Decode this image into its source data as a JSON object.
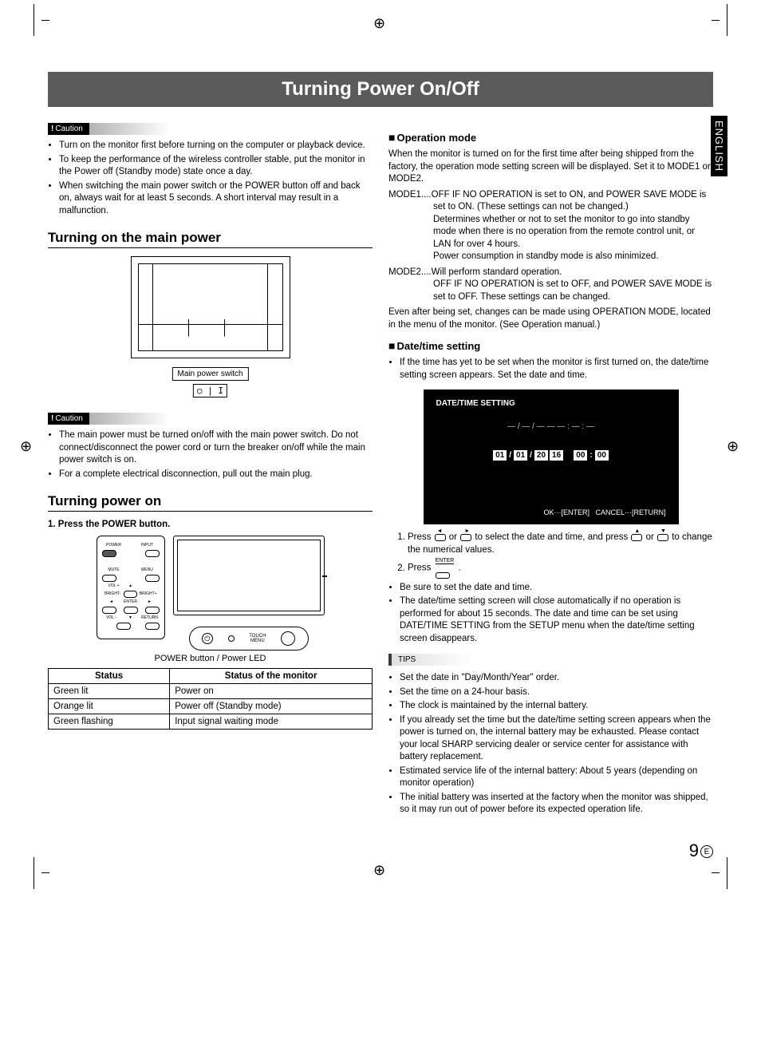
{
  "language_tab": "ENGLISH",
  "page_title": "Turning Power On/Off",
  "page_number": "9",
  "page_lang_mark": "E",
  "caution_label": "Caution",
  "caution_top": [
    "Turn on the monitor first before turning on the computer or playback device.",
    "To keep the performance of the wireless controller stable, put the monitor in the Power off (Standby mode) state once a day.",
    "When switching the main power switch or the POWER button off and back on, always wait for at least 5 seconds. A short interval may result in a malfunction."
  ],
  "section1_title": "Turning on the main power",
  "main_power_label": "Main power switch",
  "main_power_symbol": "○ | I",
  "caution_mid": [
    "The main power must be turned on/off with the main power switch. Do not connect/disconnect the power cord or turn the breaker on/off while the main power switch is on.",
    "For a complete electrical disconnection, pull out the main plug."
  ],
  "section2_title": "Turning power on",
  "step1": "1. Press the POWER button.",
  "remote": {
    "power": "POWER",
    "input": "INPUT",
    "mute": "MUTE",
    "menu": "MENU",
    "volp": "VOL +",
    "brightm": "BRIGHT-",
    "brightp": "BRIGHT+",
    "left": "◄",
    "enter": "ENTER",
    "right": "►",
    "volm": "VOL -",
    "down": "▼",
    "return": "RETURN"
  },
  "control_bar": {
    "touch_menu": "TOUCH\nMENU"
  },
  "fig_caption": "POWER button / Power LED",
  "led_table": {
    "headers": [
      "Status",
      "Status of the monitor"
    ],
    "rows": [
      [
        "Green lit",
        "Power on"
      ],
      [
        "Orange lit",
        "Power off (Standby mode)"
      ],
      [
        "Green flashing",
        "Input signal waiting mode"
      ]
    ]
  },
  "op_mode_title": "Operation mode",
  "op_mode_intro": "When the monitor is turned on for the first time after being shipped from the factory, the operation mode setting screen will be displayed. Set it to MODE1 or MODE2.",
  "mode1": "MODE1....OFF IF NO OPERATION is set to ON, and POWER SAVE MODE is set to ON. (These settings can not be changed.)\nDetermines whether or not to set the monitor to go into standby mode when there is no operation from the remote control unit, or LAN for over 4 hours.\nPower consumption in standby mode is also minimized.",
  "mode2": "MODE2....Will perform standard operation.\nOFF IF NO OPERATION is set to OFF, and POWER SAVE MODE is set to OFF. These settings can be changed.",
  "op_mode_note": "Even after being set, changes can be made using OPERATION MODE, located in the menu of the monitor. (See Operation manual.)",
  "dt_title": "Date/time setting",
  "dt_intro": "If the time has yet to be set when the monitor is first turned on, the date/time setting screen appears. Set the date and time.",
  "dt_screen": {
    "title": "DATE/TIME SETTING",
    "blank": "— / — / — —    — : — : —",
    "d1": "01",
    "d2": "01",
    "y1": "20",
    "y2": "16",
    "h": "00",
    "m": "00",
    "ok": "OK···[ENTER]",
    "cancel": "CANCEL···[RETURN]"
  },
  "dt_steps": {
    "s1a": "Press ",
    "s1b": " or ",
    "s1c": " to select the date and time, and press ",
    "s1d": " or ",
    "s1e": " to change the numerical values.",
    "s2a": "Press ",
    "s2_enter": "ENTER",
    "s2b": " ."
  },
  "dt_bullets": [
    "Be sure to set the date and time.",
    "The date/time setting screen will close automatically if no operation is performed for about 15 seconds. The date and time can be set using DATE/TIME SETTING from the SETUP menu when the date/time setting screen disappears."
  ],
  "tips_label": "TIPS",
  "tips_list": [
    "Set the date in \"Day/Month/Year\" order.",
    "Set the time on a 24-hour basis.",
    "The clock is maintained by the internal battery.",
    "If you already set the time but the date/time setting screen appears when the power is turned on, the internal battery may be exhausted. Please contact your local SHARP servicing dealer or service center for assistance with battery replacement.",
    "Estimated service life of the internal battery: About 5 years (depending on monitor operation)",
    "The initial battery was inserted at the factory when the monitor was shipped, so it may run out of power before its expected operation life."
  ]
}
